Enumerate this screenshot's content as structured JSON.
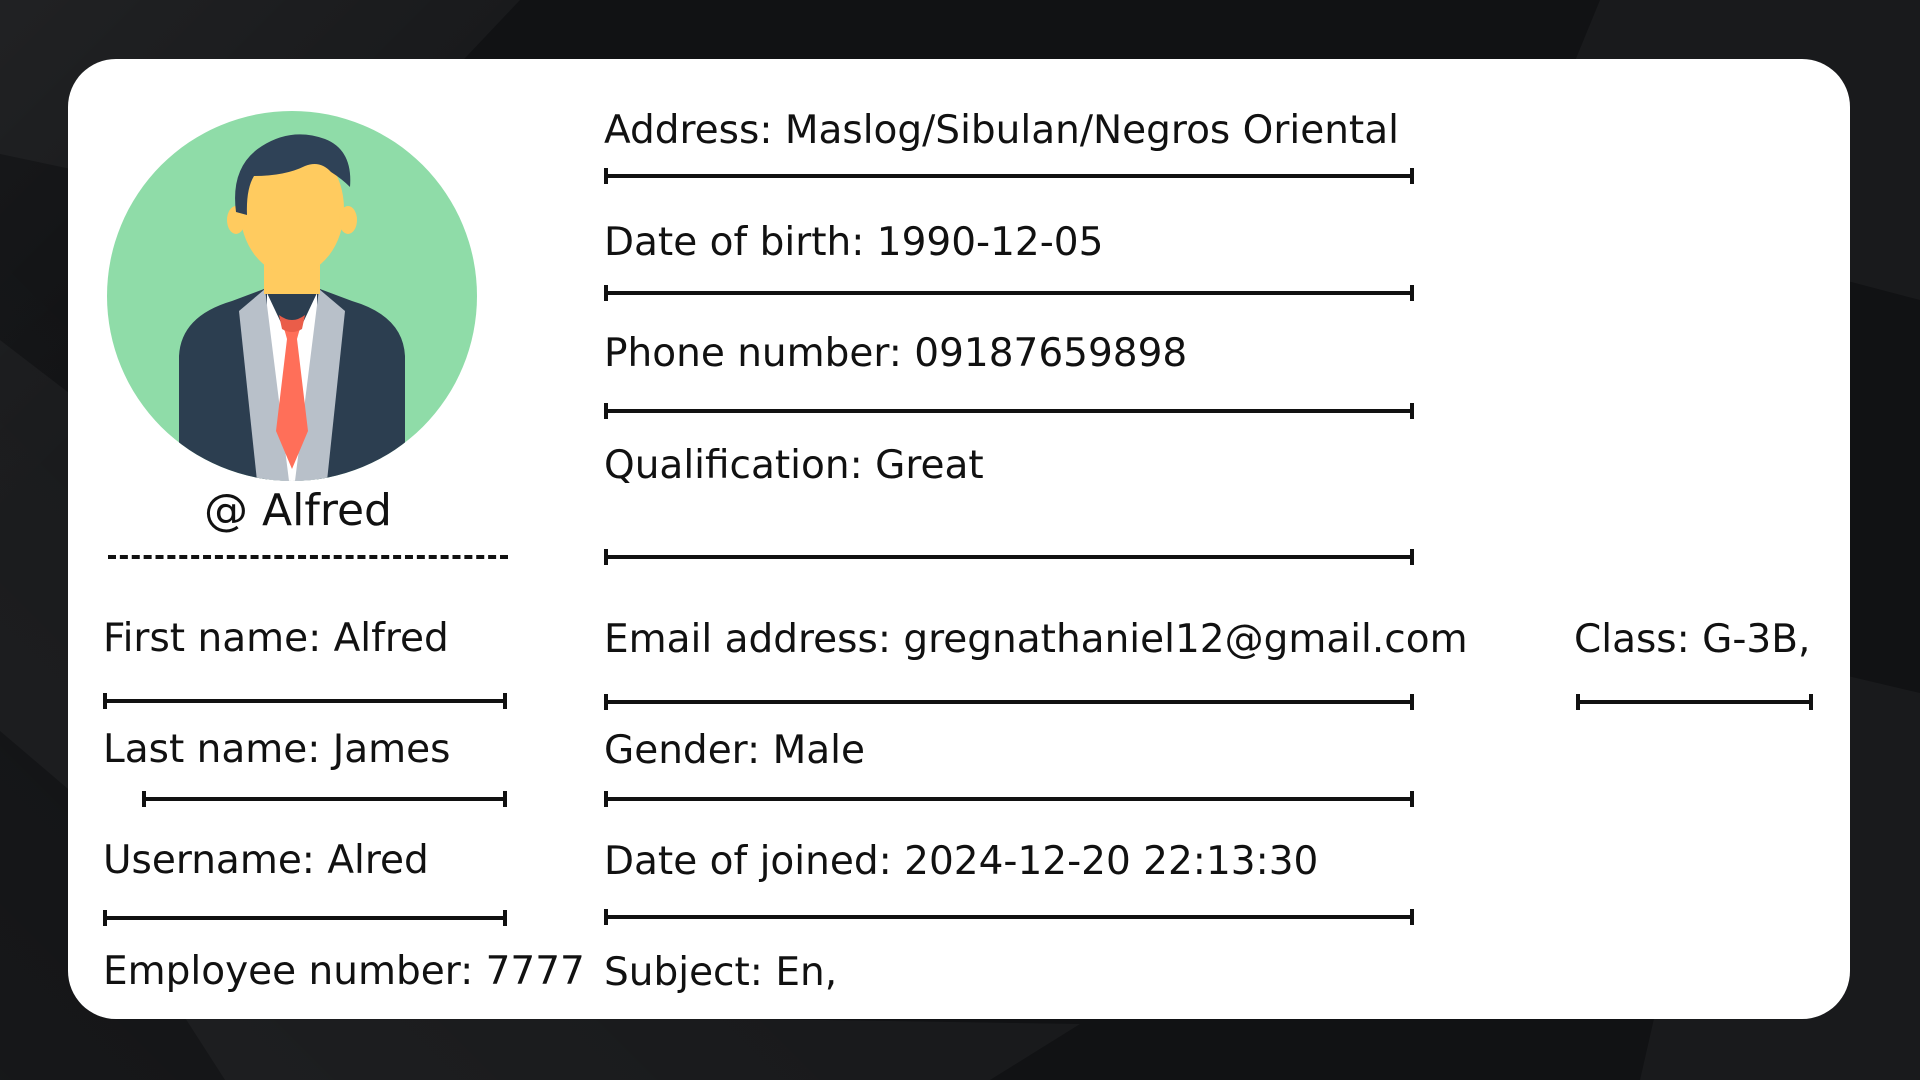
{
  "profile": {
    "handle": "@ Alfred",
    "avatar_icon": "businessman-avatar-icon",
    "avatar_colors": {
      "circle": "#8fdca8",
      "suit": "#2c3e50",
      "face": "#ffcb5f",
      "hair": "#2f4257",
      "tie": "#ff6f59",
      "shirt": "#ffffff"
    }
  },
  "left_fields": {
    "first_name": "First name: Alfred",
    "last_name": "Last name: James",
    "username": "Username: Alred",
    "employee_number": "Employee number: 7777"
  },
  "main_fields": {
    "address": "Address: Maslog/Sibulan/Negros Oriental",
    "date_of_birth": "Date of birth: 1990-12-05",
    "phone_number": "Phone number: 09187659898",
    "qualification": "Qualification: Great",
    "email_address": "Email address: gregnathaniel12@gmail.com",
    "gender": "Gender: Male",
    "date_joined": "Date of joined: 2024-12-20 22:13:30",
    "subject": "Subject: En,"
  },
  "right_fields": {
    "class": "Class: G-3B,"
  }
}
